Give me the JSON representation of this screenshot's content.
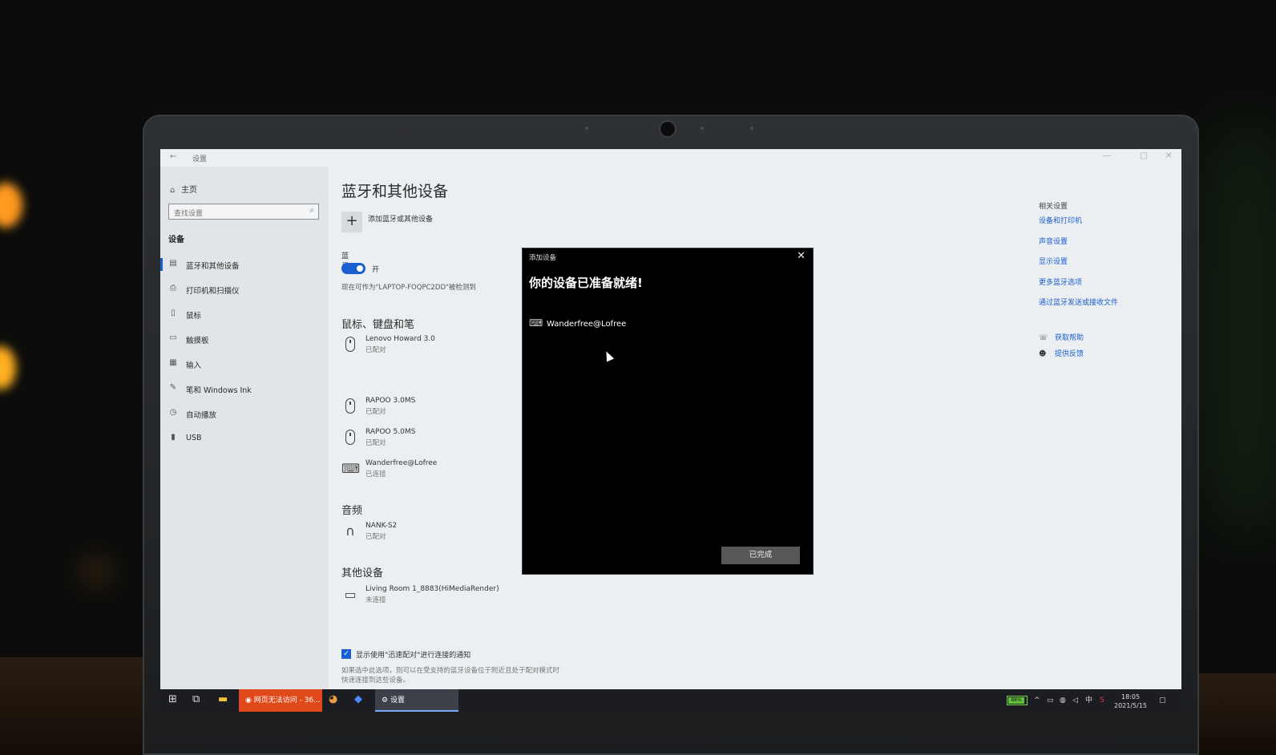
{
  "window": {
    "title": "设置",
    "back_icon": "back-arrow-icon"
  },
  "sidebar": {
    "home_label": "主页",
    "search_placeholder": "查找设置",
    "section_label": "设备",
    "items": [
      {
        "label": "蓝牙和其他设备",
        "icon": "bluetooth-devices-icon",
        "active": true
      },
      {
        "label": "打印机和扫描仪",
        "icon": "printer-icon"
      },
      {
        "label": "鼠标",
        "icon": "mouse-icon"
      },
      {
        "label": "触摸板",
        "icon": "touchpad-icon"
      },
      {
        "label": "输入",
        "icon": "keyboard-icon"
      },
      {
        "label": "笔和 Windows Ink",
        "icon": "pen-icon"
      },
      {
        "label": "自动播放",
        "icon": "autoplay-icon"
      },
      {
        "label": "USB",
        "icon": "usb-icon"
      }
    ]
  },
  "main": {
    "title": "蓝牙和其他设备",
    "add_device_label": "添加蓝牙或其他设备",
    "bluetooth_label": "蓝牙",
    "bluetooth_state": "开",
    "discoverable_text": "现在可作为\"LAPTOP-FOQPC2DD\"被检测到",
    "groups": {
      "input": {
        "title": "鼠标、键盘和笔",
        "devices": [
          {
            "name": "Lenovo Howard 3.0",
            "status": "已配对",
            "icon": "mouse-icon"
          },
          {
            "name": "RAPOO 3.0MS",
            "status": "已配对",
            "icon": "mouse-icon"
          },
          {
            "name": "RAPOO 5.0MS",
            "status": "已配对",
            "icon": "mouse-icon"
          },
          {
            "name": "Wanderfree@Lofree",
            "status": "已连接",
            "icon": "keyboard-icon"
          }
        ]
      },
      "audio": {
        "title": "音频",
        "devices": [
          {
            "name": "NANK-S2",
            "status": "已配对",
            "icon": "headphones-icon"
          }
        ]
      },
      "other": {
        "title": "其他设备",
        "devices": [
          {
            "name": "Living Room 1_8883(HiMediaRender)",
            "status": "未连接",
            "icon": "media-renderer-icon"
          }
        ]
      }
    },
    "swift_pair_label": "显示使用\"迅速配对\"进行连接的通知",
    "swift_pair_checked": true,
    "swift_pair_hint_1": "如果选中此选项，则可以在受支持的蓝牙设备位于附近且处于配对模式时",
    "swift_pair_hint_2": "快速连接到这些设备。"
  },
  "related": {
    "heading": "相关设置",
    "links": [
      "设备和打印机",
      "声音设置",
      "显示设置",
      "更多蓝牙选项",
      "通过蓝牙发送或接收文件"
    ],
    "help": [
      "获取帮助",
      "提供反馈"
    ]
  },
  "dialog": {
    "title": "添加设备",
    "heading": "你的设备已准备就绪!",
    "device_name": "Wanderfree@Lofree",
    "done_label": "已完成"
  },
  "taskbar": {
    "browser_task": "网页无法访问 - 36...",
    "settings_task": "设置",
    "battery": "88%",
    "ime": "中",
    "time": "18:05",
    "date": "2021/5/15"
  },
  "colors": {
    "accent": "#1a5fd0",
    "taskbar": "#1b1d22",
    "dialog_bg": "#000000"
  }
}
